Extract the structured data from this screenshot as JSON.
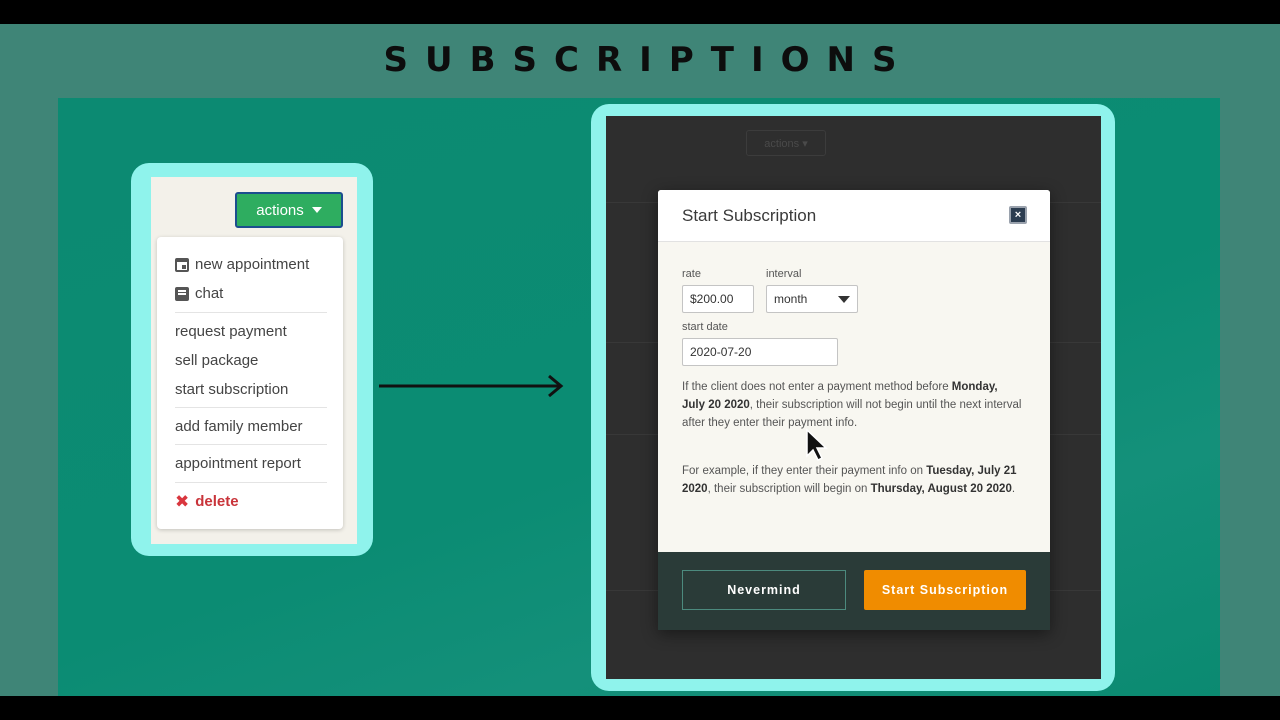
{
  "slide": {
    "title": "SUBSCRIPTIONS"
  },
  "dropdown": {
    "actions_label": "actions",
    "items": {
      "new_appointment": "new appointment",
      "chat": "chat",
      "request_payment": "request payment",
      "sell_package": "sell package",
      "start_subscription": "start subscription",
      "add_family_member": "add family member",
      "appointment_report": "appointment report",
      "delete": "delete"
    }
  },
  "background_app": {
    "actions_label": "actions ▾"
  },
  "modal": {
    "title": "Start Subscription",
    "close_symbol": "×",
    "rate_label": "rate",
    "rate_value": "$200.00",
    "interval_label": "interval",
    "interval_value": "month",
    "start_date_label": "start date",
    "start_date_value": "2020-07-20",
    "para1": {
      "pre": "If the client does not enter a payment method before",
      "bold": "Monday, July 20 2020",
      "post": ", their subscription will not begin until the next interval after they enter their payment info."
    },
    "para2": {
      "pre": "For example, if they enter their payment info on",
      "bold1": "Tuesday, July 21 2020",
      "mid": ", their subscription will begin on",
      "bold2": "Thursday, August 20 2020",
      "end": "."
    },
    "nevermind_label": "Nevermind",
    "start_label": "Start Subscription"
  },
  "colors": {
    "accent_green": "#2ead60",
    "frame_cyan": "#8ff3ec",
    "panel_teal": "#0b8c73",
    "start_orange": "#f08c00",
    "delete_red": "#c9343a"
  }
}
